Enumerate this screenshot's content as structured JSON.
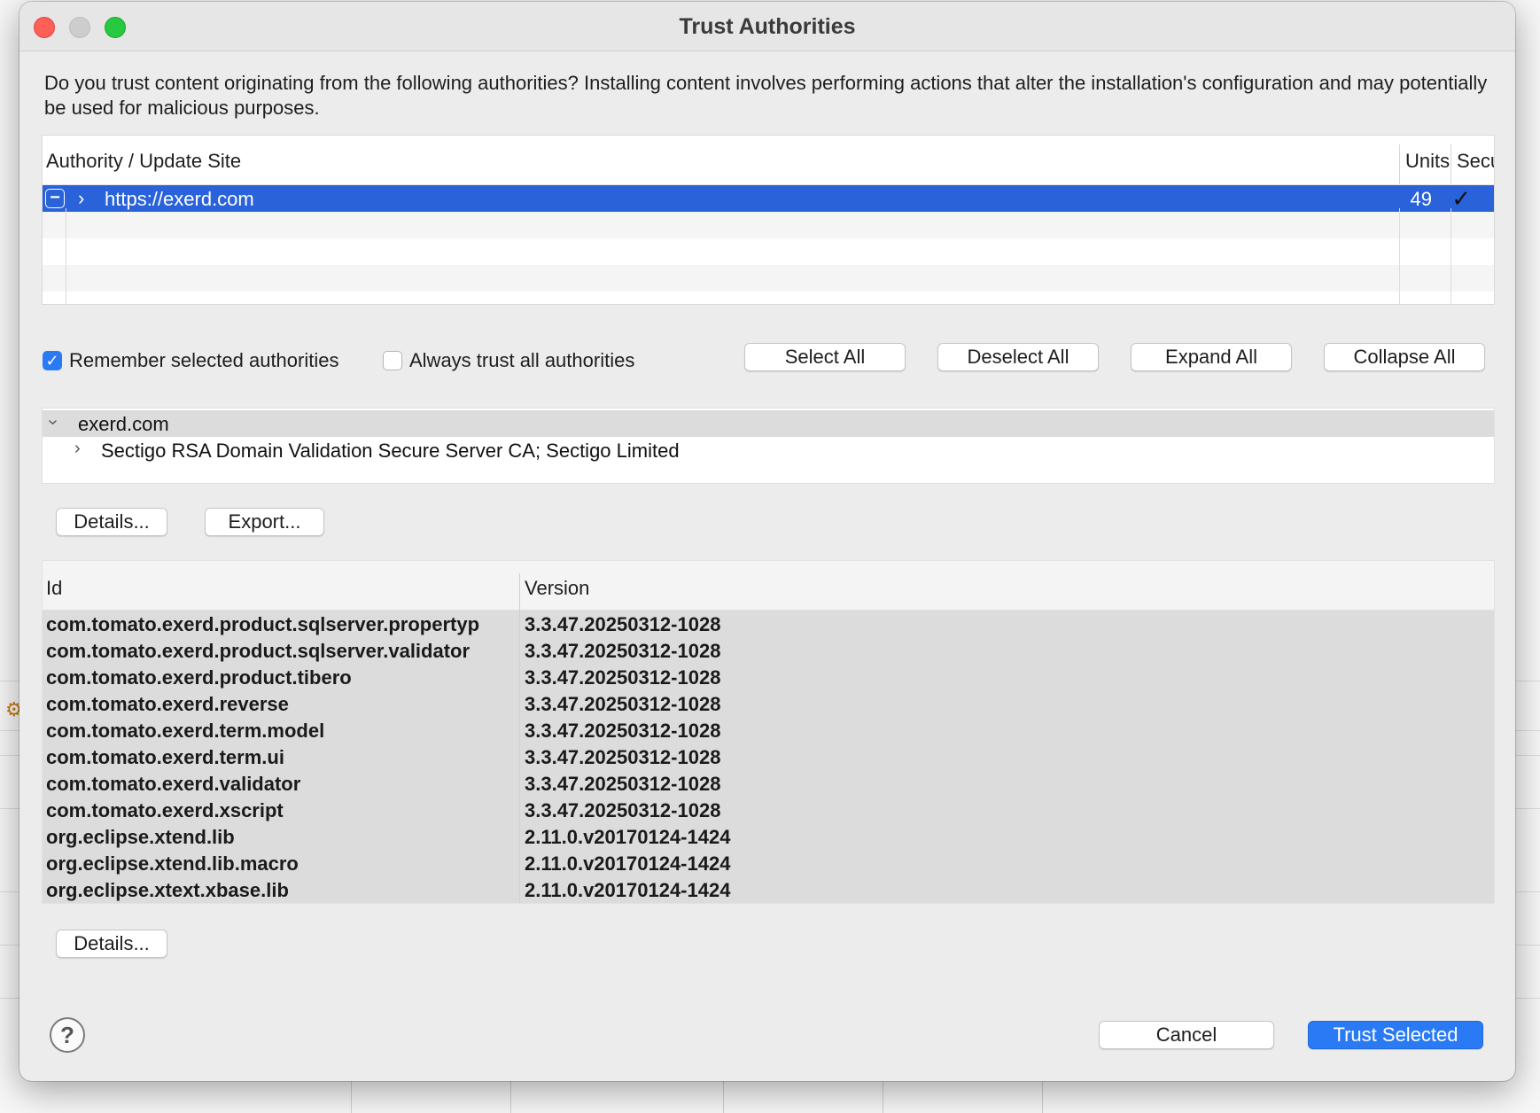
{
  "window": {
    "title": "Trust Authorities"
  },
  "intro": "Do you trust content originating from the following authorities?  Installing content involves performing actions that alter the installation's configuration and may potentially be used for malicious purposes.",
  "authorities_table": {
    "columns": [
      "Authority / Update Site",
      "Units",
      "Secur"
    ],
    "rows": [
      {
        "site": "https://exerd.com",
        "units": "49",
        "secure": "✓",
        "checked": "−",
        "expand": "›"
      }
    ]
  },
  "options": {
    "remember_label": "Remember selected authorities",
    "remember_checked": true,
    "always_label": "Always trust all authorities",
    "always_checked": false
  },
  "buttons": {
    "select_all": "Select All",
    "deselect_all": "Deselect All",
    "expand_all": "Expand All",
    "collapse_all": "Collapse All",
    "details": "Details...",
    "export": "Export...",
    "details2": "Details...",
    "cancel": "Cancel",
    "trust_selected": "Trust Selected",
    "help": "?"
  },
  "certificate_tree": {
    "root": "exerd.com",
    "child": "Sectigo RSA Domain Validation Secure Server CA; Sectigo Limited"
  },
  "units_table": {
    "columns": [
      "Id",
      "Version"
    ],
    "rows": [
      {
        "id": "com.tomato.exerd.product.sqlserver.propertyp",
        "version": "3.3.47.20250312-1028"
      },
      {
        "id": "com.tomato.exerd.product.sqlserver.validator",
        "version": "3.3.47.20250312-1028"
      },
      {
        "id": "com.tomato.exerd.product.tibero",
        "version": "3.3.47.20250312-1028"
      },
      {
        "id": "com.tomato.exerd.reverse",
        "version": "3.3.47.20250312-1028"
      },
      {
        "id": "com.tomato.exerd.term.model",
        "version": "3.3.47.20250312-1028"
      },
      {
        "id": "com.tomato.exerd.term.ui",
        "version": "3.3.47.20250312-1028"
      },
      {
        "id": "com.tomato.exerd.validator",
        "version": "3.3.47.20250312-1028"
      },
      {
        "id": "com.tomato.exerd.xscript",
        "version": "3.3.47.20250312-1028"
      },
      {
        "id": "org.eclipse.xtend.lib",
        "version": "2.11.0.v20170124-1424"
      },
      {
        "id": "org.eclipse.xtend.lib.macro",
        "version": "2.11.0.v20170124-1424"
      },
      {
        "id": "org.eclipse.xtext.xbase.lib",
        "version": "2.11.0.v20170124-1424"
      }
    ]
  },
  "colors": {
    "selection": "#2a62d9",
    "primary_button": "#2a7af6",
    "close": "#fe5f57",
    "minimize": "#cdcdcd",
    "zoom": "#28c840"
  }
}
